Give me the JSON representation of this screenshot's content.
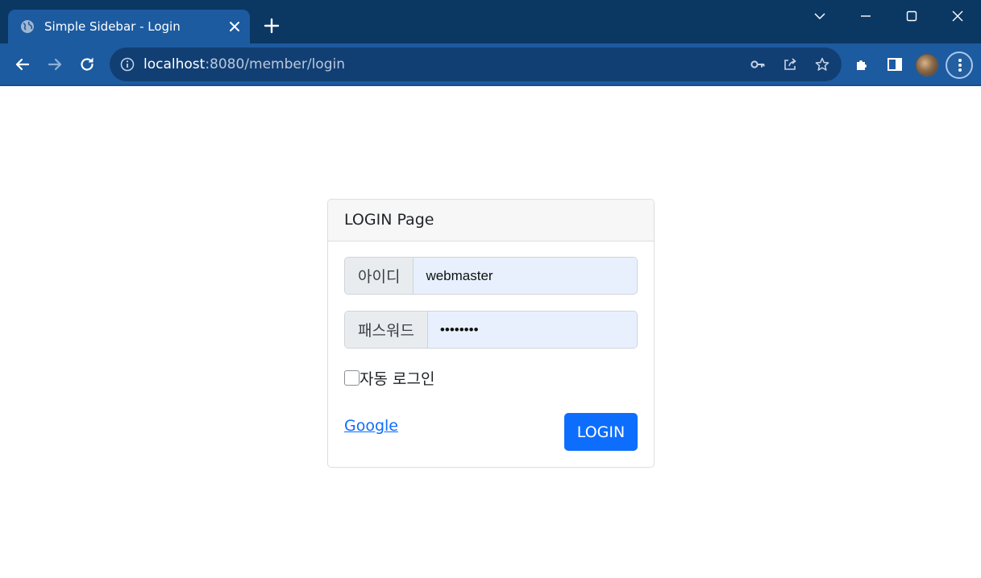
{
  "browser": {
    "tab": {
      "title": "Simple Sidebar - Login"
    },
    "address": {
      "host": "localhost",
      "path": ":8080/member/login"
    }
  },
  "login": {
    "header": "LOGIN Page",
    "username": {
      "label": "아이디",
      "value": "webmaster"
    },
    "password": {
      "label": "패스워드",
      "value": "ab1234!!"
    },
    "remember_label": "자동 로그인",
    "link_label": "Google",
    "submit_label": "LOGIN"
  },
  "colors": {
    "titlebar": "#0b3763",
    "toolbar": "#1d5ba0",
    "primary": "#0d6efd",
    "autofill": "#e8f0fe"
  }
}
